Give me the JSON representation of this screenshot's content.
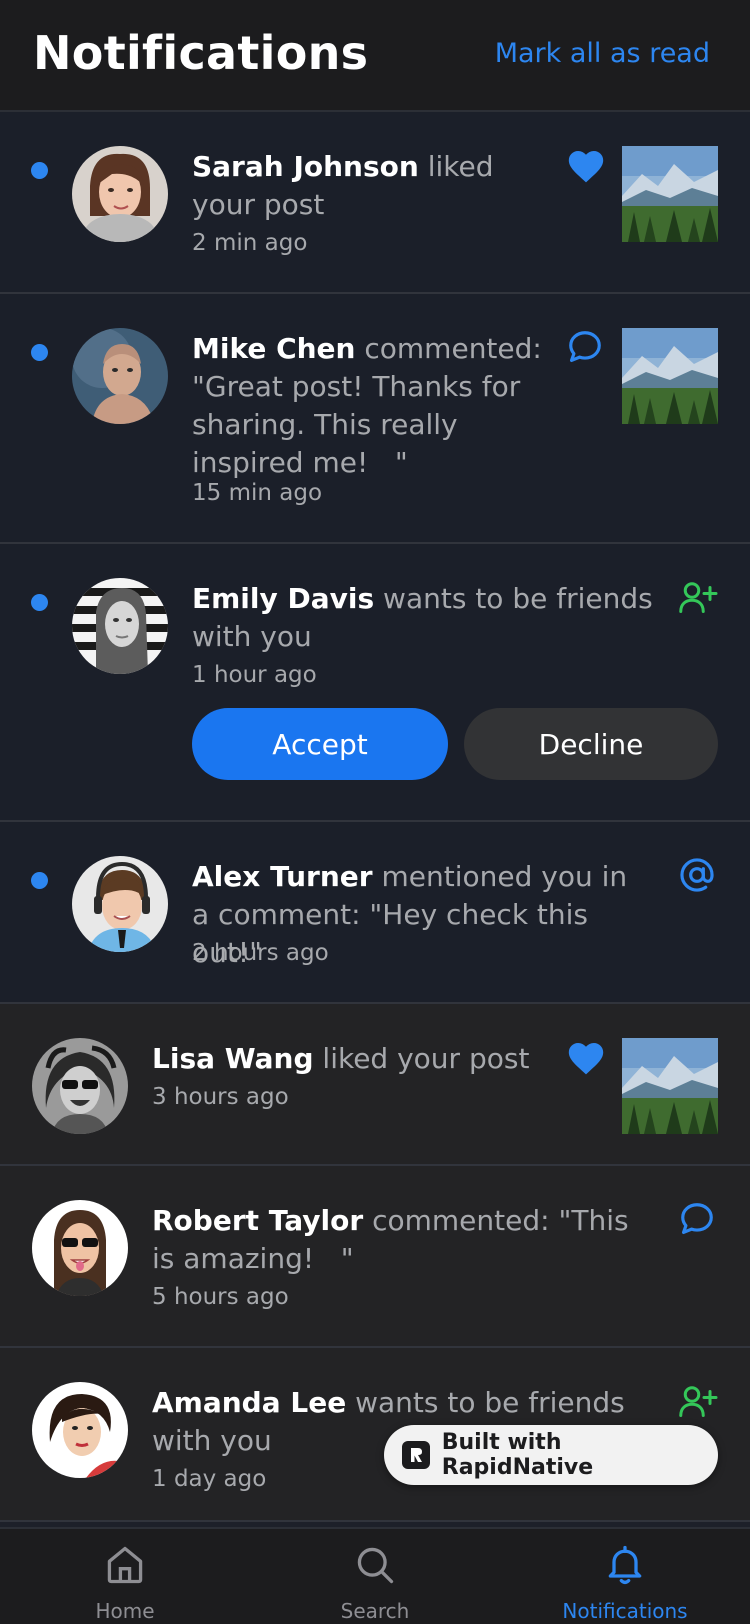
{
  "header": {
    "title": "Notifications",
    "mark_all_label": "Mark all as read"
  },
  "notifications": [
    {
      "name": "Sarah Johnson",
      "text": " liked your post",
      "time": "2 min ago",
      "type": "like",
      "icon": "heart-icon",
      "unread": true,
      "has_thumbnail": true
    },
    {
      "name": "Mike Chen",
      "text": " commented: \"Great post! Thanks for sharing. This really inspired me!   \"",
      "time": "15 min ago",
      "type": "comment",
      "icon": "comment-icon",
      "unread": true,
      "has_thumbnail": true
    },
    {
      "name": "Emily Davis",
      "text": " wants to be friends with you",
      "time": "1 hour ago",
      "type": "friend_request",
      "icon": "user-plus-icon",
      "unread": true,
      "accept_label": "Accept",
      "decline_label": "Decline"
    },
    {
      "name": "Alex Turner",
      "text": " mentioned you in a comment: \"Hey check this out!\"",
      "time": "2 hours ago",
      "type": "mention",
      "icon": "at-icon",
      "unread": true
    },
    {
      "name": "Lisa Wang",
      "text": " liked your post",
      "time": "3 hours ago",
      "type": "like",
      "icon": "heart-icon",
      "unread": false,
      "has_thumbnail": true
    },
    {
      "name": "Robert Taylor",
      "text": " commented: \"This is amazing!   \"",
      "time": "5 hours ago",
      "type": "comment",
      "icon": "comment-icon",
      "unread": false
    },
    {
      "name": "Amanda Lee",
      "text": " wants to be friends with you",
      "time": "1 day ago",
      "type": "friend_request",
      "icon": "user-plus-icon",
      "unread": false
    }
  ],
  "badge": {
    "label": "Built with RapidNative"
  },
  "tabs": [
    {
      "label": "Home",
      "icon": "home-icon",
      "active": false
    },
    {
      "label": "Search",
      "icon": "search-icon",
      "active": false
    },
    {
      "label": "Notifications",
      "icon": "bell-icon",
      "active": true
    }
  ],
  "colors": {
    "accent": "#2d86f0",
    "friend_green": "#34c759",
    "unread_bg": "#1b1f29",
    "read_bg": "#232325"
  }
}
